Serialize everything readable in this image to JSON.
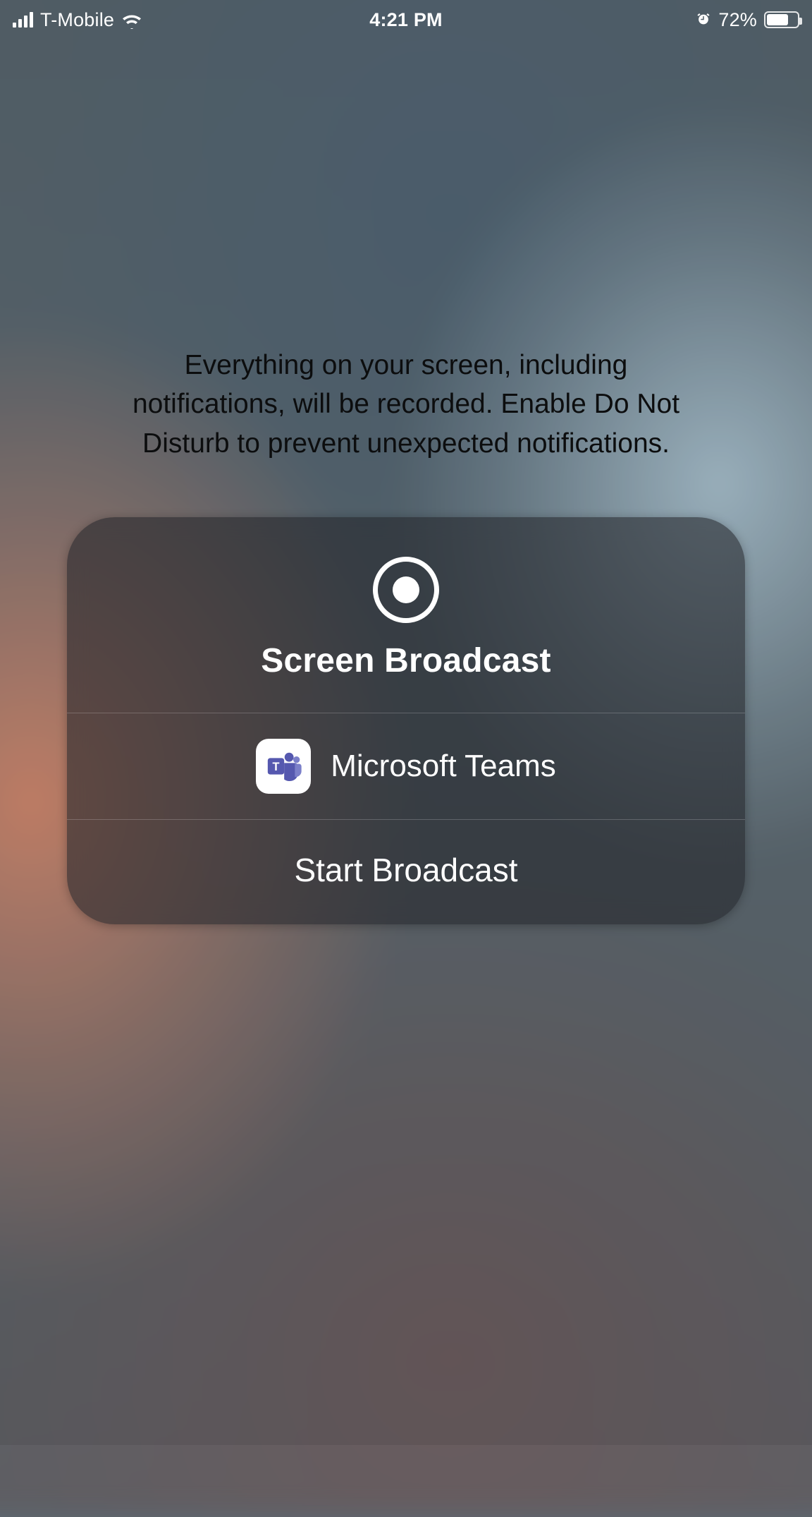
{
  "status_bar": {
    "carrier": "T-Mobile",
    "time": "4:21 PM",
    "battery_percent": "72%",
    "battery_fill_percent": 72,
    "alarm_icon": "alarm-icon",
    "wifi_icon": "wifi-icon",
    "signal_icon": "cellular-signal-icon",
    "battery_icon": "battery-icon"
  },
  "warning_text": "Everything on your screen, including notifications, will be recorded. Enable Do Not Disturb to prevent unexpected notifications.",
  "panel": {
    "title": "Screen Broadcast",
    "record_icon": "record-icon",
    "app": {
      "name": "Microsoft Teams",
      "icon": "microsoft-teams-icon",
      "icon_color": "#5558AF"
    },
    "start_label": "Start Broadcast"
  }
}
